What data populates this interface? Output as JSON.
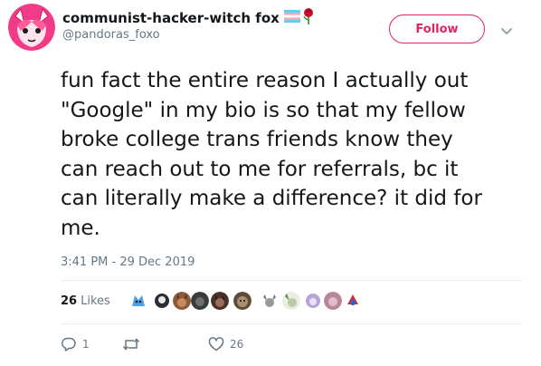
{
  "author": {
    "display_name": "communist-hacker-witch fox",
    "handle": "@pandoras_foxo",
    "name_emojis": [
      "transgender-flag-icon",
      "rose-icon"
    ]
  },
  "follow_button": {
    "label": "Follow"
  },
  "tweet": {
    "text": "fun fact the entire reason I actually out\n\"Google\" in my bio is so that my fellow\nbroke college trans friends know they\ncan reach out to me for referrals, bc it\ncan literally make a difference? it did for\nme.",
    "timestamp": "3:41 PM - 29 Dec 2019"
  },
  "stats": {
    "likes_count": "26",
    "likes_label": "Likes",
    "liker_avatars": 10
  },
  "actions": {
    "reply_count": "1",
    "retweet_count": "",
    "like_count": "26"
  },
  "colors": {
    "follow_accent": "#e0245e",
    "secondary_text": "#657786",
    "divider": "#e6ecf0",
    "primary_text": "#14171a"
  }
}
